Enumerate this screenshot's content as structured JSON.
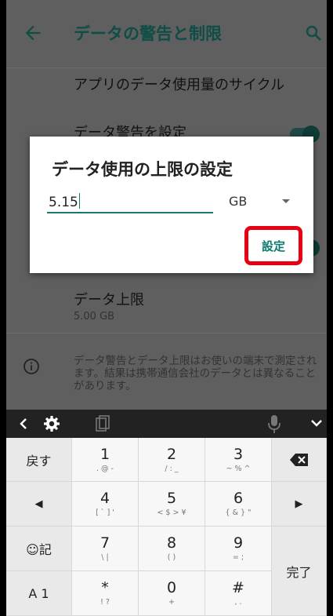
{
  "header": {
    "title": "データの警告と制限"
  },
  "settings": {
    "cycle_label": "アプリのデータ使用量のサイクル",
    "warning_label": "データ警告を設定",
    "limit_label": "データ上限",
    "limit_value": "5.00 GB",
    "info_text": "データ警告とデータ上限はお使いの端末で測定されます。結果は携帯通信会社のデータとは異なることがあります。"
  },
  "dialog": {
    "title": "データ使用の上限の設定",
    "value": "5.15",
    "unit": "GB",
    "set_label": "設定"
  },
  "keyboard": {
    "keys": [
      {
        "main": "戻す"
      },
      {
        "main": "1",
        "sub": ". @ -"
      },
      {
        "main": "2",
        "sub": "/ : _"
      },
      {
        "main": "3",
        "sub": "~ % ^"
      },
      {
        "main": "◀"
      },
      {
        "main": "4",
        "sub": "[ ` ] '"
      },
      {
        "main": "5",
        "sub": "< $ > ¥"
      },
      {
        "main": "6",
        "sub": "{ & } \""
      },
      {
        "main": "▶"
      },
      {
        "main": "☺記"
      },
      {
        "main": "7",
        "sub": "\\ |"
      },
      {
        "main": "8",
        "sub": "( )"
      },
      {
        "main": "9",
        "sub": "= ;"
      },
      {
        "main": "A 1"
      },
      {
        "main": "*",
        "sub": "! ?"
      },
      {
        "main": "0",
        "sub": "+"
      },
      {
        "main": "#",
        "sub": ", ."
      },
      {
        "main": "完了"
      }
    ]
  },
  "colors": {
    "accent": "#1a7a72",
    "highlight_border": "#e60012",
    "scrim_bg": "#5f5f5f"
  },
  "icons": [
    "back-arrow-icon",
    "search-icon",
    "info-icon",
    "chevron-left-icon",
    "gear-icon",
    "clipboard-icon",
    "mic-icon",
    "chevron-down-icon",
    "backspace-icon"
  ]
}
